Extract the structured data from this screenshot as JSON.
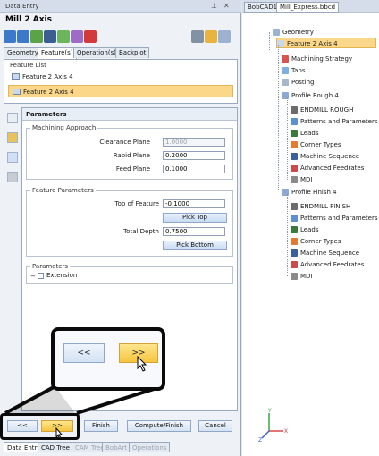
{
  "left_panel": {
    "title": "Data Entry",
    "header": "Mill 2 Axis",
    "tabs": [
      "Geometry",
      "Feature(s)",
      "Operation(s)",
      "Backplot"
    ],
    "feature_list": {
      "label": "Feature List",
      "items": [
        "Feature 2 Axis 4",
        "Feature 2 Axis 4"
      ]
    },
    "parameters_header": "Parameters",
    "machining_approach": {
      "title": "Machining Approach",
      "clearance_label": "Clearance Plane",
      "clearance_value": "1.0000",
      "rapid_label": "Rapid Plane",
      "rapid_value": "0.2000",
      "feed_label": "Feed Plane",
      "feed_value": "0.1000"
    },
    "feature_parameters": {
      "title": "Feature Parameters",
      "top_label": "Top of Feature",
      "top_value": "-0.1000",
      "pick_top": "Pick Top",
      "depth_label": "Total Depth",
      "depth_value": "0.7500",
      "pick_bottom": "Pick Bottom"
    },
    "parameters_group": {
      "title": "Parameters",
      "extension_label": "Extension"
    },
    "zoom": {
      "prev": "<<",
      "next": ">>"
    },
    "buttons": {
      "prev": "<<",
      "next": ">>",
      "finish": "Finish",
      "compute": "Compute/Finish",
      "cancel": "Cancel"
    },
    "bottom_tabs": [
      "Data Entry",
      "CAD Tree",
      "CAM Tree",
      "BobArt",
      "Operations"
    ]
  },
  "right_panel": {
    "tabs": [
      "BobCAD1",
      "Mill_Express.bbcd"
    ],
    "tree": [
      {
        "label": "Geometry",
        "icon": "geometry-icon"
      },
      {
        "label": "Feature 2 Axis 4",
        "icon": "feature-icon"
      },
      {
        "label": "Machining Strategy",
        "icon": "strategy-icon"
      },
      {
        "label": "Tabs",
        "icon": "tabs-icon"
      },
      {
        "label": "Posting",
        "icon": "posting-icon"
      },
      {
        "label": "Profile Rough 4",
        "icon": "profile-icon"
      },
      {
        "label": "ENDMILL ROUGH",
        "icon": "endmill-icon"
      },
      {
        "label": "Patterns and Parameters",
        "icon": "patterns-icon"
      },
      {
        "label": "Leads",
        "icon": "leads-icon"
      },
      {
        "label": "Corner Types",
        "icon": "corner-icon"
      },
      {
        "label": "Machine Sequence",
        "icon": "sequence-icon"
      },
      {
        "label": "Advanced Feedrates",
        "icon": "feedrates-icon"
      },
      {
        "label": "MDI",
        "icon": "mdi-icon"
      },
      {
        "label": "Profile Finish 4",
        "icon": "profile-icon"
      },
      {
        "label": "ENDMILL FINISH",
        "icon": "endmill-icon"
      },
      {
        "label": "Patterns and Parameters",
        "icon": "patterns-icon"
      },
      {
        "label": "Leads",
        "icon": "leads-icon"
      },
      {
        "label": "Corner Types",
        "icon": "corner-icon"
      },
      {
        "label": "Machine Sequence",
        "icon": "sequence-icon"
      },
      {
        "label": "Advanced Feedrates",
        "icon": "feedrates-icon"
      },
      {
        "label": "MDI",
        "icon": "mdi-icon"
      }
    ],
    "axis": {
      "x": "X",
      "y": "Y",
      "z": "Z"
    }
  },
  "colors": {
    "selection": "#fbd78a",
    "selection_border": "#e3b554",
    "panel_bg": "#eef2f7",
    "accent_blue": "#c8dbf4",
    "next_button": "#fcd35a"
  }
}
